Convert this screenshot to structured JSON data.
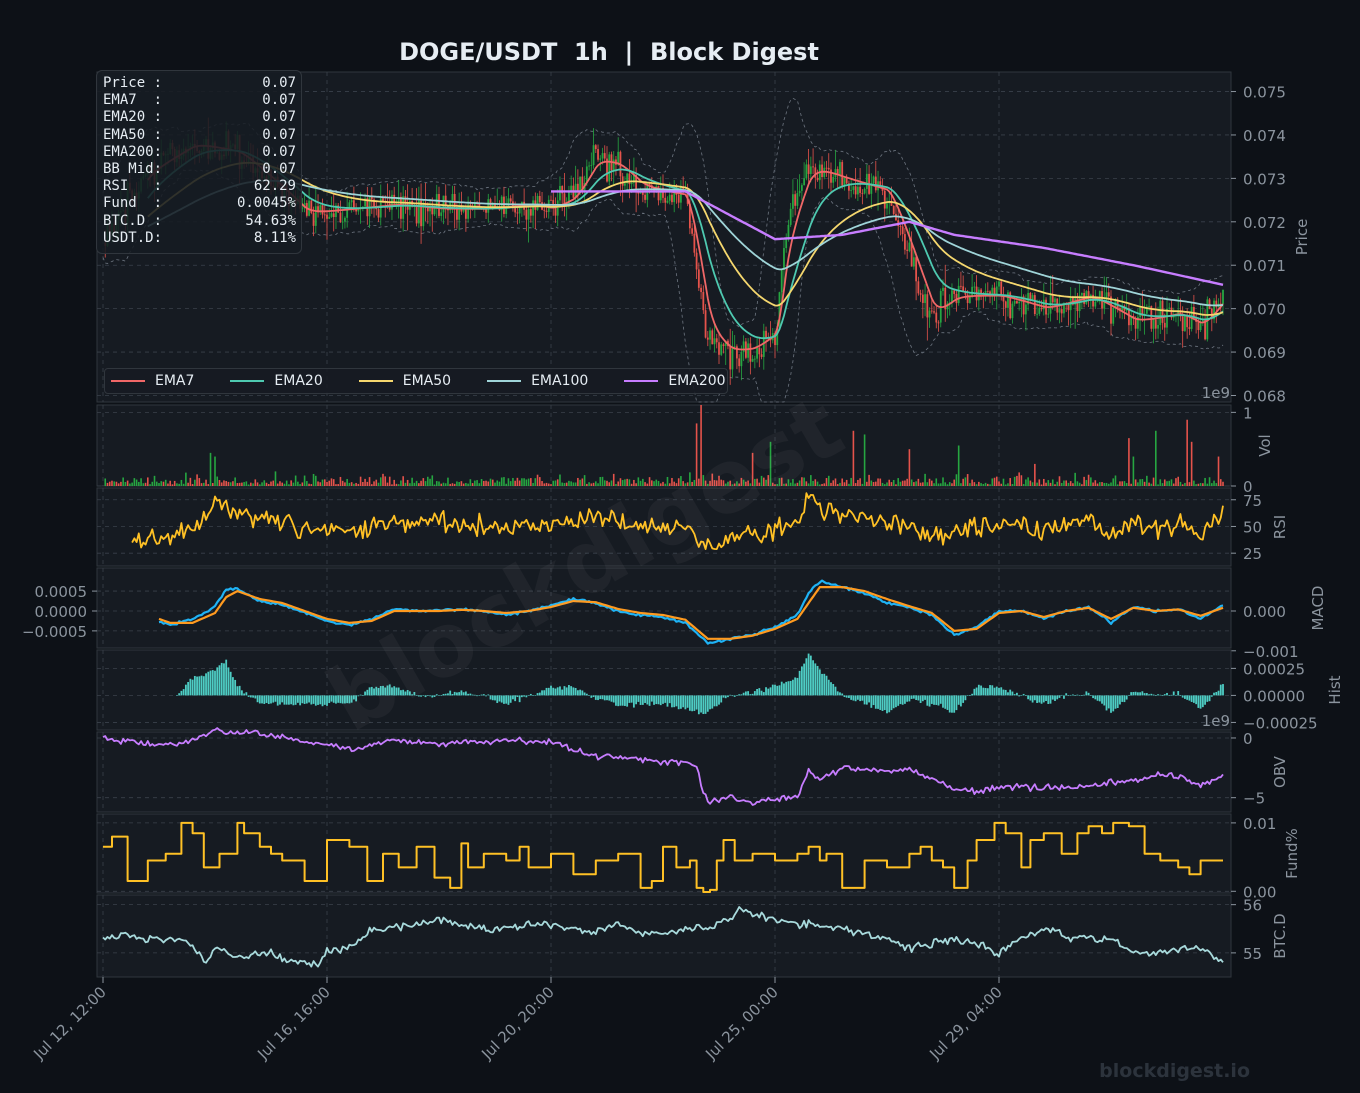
{
  "title": "DOGE/USDT  1h  |  Block Digest",
  "watermark": "blockdigest",
  "footer_brand": "blockdigest.io",
  "colors": {
    "background": "#0d1117",
    "panel": "#161b22",
    "grid": "#3a414b",
    "axis_text": "#8b949e",
    "candle_up": "#26a641",
    "candle_down": "#e5534b",
    "ema7": "#f06767",
    "ema20": "#4ec9b0",
    "ema50": "#f5d76e",
    "ema100": "#9fd4d8",
    "ema200": "#c77dff",
    "rsi": "#ffc125",
    "macd": "#1fb3f5",
    "signal": "#ff9a1f",
    "hist": "#4ecdc4",
    "obv": "#c77dff",
    "funding": "#ffc125",
    "btcd": "#a8dadc"
  },
  "info_box": [
    {
      "label": "Price :",
      "value": "0.07"
    },
    {
      "label": "EMA7  :",
      "value": "0.07"
    },
    {
      "label": "EMA20 :",
      "value": "0.07"
    },
    {
      "label": "EMA50 :",
      "value": "0.07"
    },
    {
      "label": "EMA200:",
      "value": "0.07"
    },
    {
      "label": "BB Mid:",
      "value": "0.07"
    },
    {
      "label": "RSI   :",
      "value": "62.29"
    },
    {
      "label": "Fund  :",
      "value": "0.0045%"
    },
    {
      "label": "BTC.D :",
      "value": "54.63%"
    },
    {
      "label": "USDT.D:",
      "value": "8.11%"
    }
  ],
  "legend": [
    {
      "label": "EMA7",
      "color": "#f06767"
    },
    {
      "label": "EMA20",
      "color": "#4ec9b0"
    },
    {
      "label": "EMA50",
      "color": "#f5d76e"
    },
    {
      "label": "EMA100",
      "color": "#9fd4d8"
    },
    {
      "label": "EMA200",
      "color": "#c77dff"
    }
  ],
  "x_axis": {
    "ticks": [
      "Jul 12, 12:00",
      "Jul 16, 16:00",
      "Jul 20, 20:00",
      "Jul 25, 00:00",
      "Jul 29, 04:00"
    ],
    "tick_hours": [
      0,
      100,
      200,
      300,
      400
    ],
    "range_hours": [
      0,
      500
    ]
  },
  "chart_data": [
    {
      "type": "line",
      "panel": "Price",
      "ylabel": "Price",
      "ylim": [
        0.06785,
        0.07545
      ],
      "yticks": [
        "0.075",
        "0.074",
        "0.073",
        "0.072",
        "0.071",
        "0.070",
        "0.069",
        "0.068"
      ],
      "ytick_values": [
        0.075,
        0.074,
        0.073,
        0.072,
        0.071,
        0.07,
        0.069,
        0.068
      ],
      "corner_label": "1e9",
      "price_anchors": {
        "x": [
          0,
          20,
          40,
          60,
          80,
          90,
          110,
          130,
          150,
          170,
          190,
          200,
          210,
          220,
          230,
          240,
          260,
          270,
          280,
          290,
          300,
          305,
          315,
          330,
          350,
          370,
          380,
          400,
          420,
          440,
          460,
          480,
          490,
          500
        ],
        "y": [
          0.0716,
          0.0732,
          0.0738,
          0.0736,
          0.0727,
          0.0722,
          0.0723,
          0.0724,
          0.0723,
          0.0723,
          0.0724,
          0.0723,
          0.0726,
          0.0735,
          0.0733,
          0.0728,
          0.0726,
          0.0693,
          0.069,
          0.0691,
          0.0695,
          0.072,
          0.0733,
          0.073,
          0.0727,
          0.0698,
          0.0703,
          0.0703,
          0.07,
          0.0703,
          0.0697,
          0.0699,
          0.0696,
          0.0703
        ]
      },
      "ema200_anchors": {
        "x": [
          200,
          260,
          300,
          330,
          360,
          380,
          420,
          460,
          500
        ],
        "y": [
          0.0727,
          0.0727,
          0.0716,
          0.0717,
          0.072,
          0.0717,
          0.0714,
          0.071,
          0.07055
        ]
      },
      "series": [
        {
          "name": "EMA7"
        },
        {
          "name": "EMA20"
        },
        {
          "name": "EMA50"
        },
        {
          "name": "EMA100"
        },
        {
          "name": "EMA200"
        }
      ]
    },
    {
      "type": "bar",
      "panel": "Volume",
      "ylabel": "Vol",
      "ylim": [
        0,
        1.1
      ],
      "yticks": [
        "1",
        "0"
      ],
      "ytick_values": [
        1,
        0
      ],
      "spikes": {
        "x": [
          48,
          50,
          265,
          267,
          290,
          298,
          335,
          340,
          360,
          382,
          416,
          458,
          460,
          470,
          484,
          486,
          498
        ],
        "y": [
          0.45,
          0.4,
          0.85,
          1.15,
          0.45,
          0.6,
          0.75,
          0.7,
          0.5,
          0.55,
          0.3,
          0.65,
          0.4,
          0.75,
          0.9,
          0.6,
          0.4
        ]
      }
    },
    {
      "type": "line",
      "panel": "RSI",
      "ylabel": "RSI",
      "ylim": [
        13,
        86
      ],
      "yticks": [
        "75",
        "50",
        "25"
      ],
      "ytick_values": [
        75,
        50,
        25
      ],
      "anchors": {
        "x": [
          13,
          20,
          30,
          40,
          46,
          50,
          60,
          70,
          90,
          110,
          130,
          150,
          170,
          190,
          210,
          220,
          240,
          260,
          265,
          270,
          280,
          290,
          300,
          310,
          315,
          320,
          330,
          345,
          360,
          370,
          380,
          390,
          400,
          420,
          440,
          450,
          460,
          470,
          480,
          490,
          500
        ],
        "y": [
          38,
          40,
          42,
          48,
          55,
          75,
          60,
          58,
          48,
          47,
          52,
          55,
          50,
          52,
          55,
          60,
          50,
          48,
          40,
          30,
          38,
          42,
          45,
          55,
          80,
          65,
          60,
          55,
          52,
          40,
          45,
          50,
          52,
          45,
          58,
          40,
          55,
          48,
          55,
          42,
          62
        ]
      }
    },
    {
      "type": "line",
      "panel": "MACD",
      "ylabel": "MACD",
      "ylim": [
        -0.00093,
        0.00108
      ],
      "yticks_left": [
        "0.0005",
        "0.0000",
        "−0.0005"
      ],
      "ytick_left_values": [
        0.0005,
        0.0,
        -0.0005
      ],
      "yticks_right": [
        "0.000",
        "−0.001"
      ],
      "ytick_right_values": [
        0.0,
        -0.001
      ],
      "macd_anchors": {
        "x": [
          25,
          30,
          40,
          50,
          55,
          60,
          70,
          80,
          90,
          100,
          110,
          120,
          130,
          140,
          150,
          160,
          170,
          180,
          190,
          200,
          210,
          220,
          230,
          240,
          250,
          260,
          270,
          280,
          290,
          300,
          310,
          315,
          320,
          330,
          340,
          350,
          360,
          370,
          380,
          390,
          400,
          410,
          420,
          430,
          440,
          450,
          460,
          470,
          480,
          490,
          500
        ],
        "y": [
          -0.00025,
          -0.00035,
          -0.0002,
          0.0001,
          0.00055,
          0.00055,
          0.00025,
          0.00015,
          -5e-05,
          -0.00025,
          -0.00035,
          -0.0002,
          5e-05,
          0.0,
          0.0,
          5e-05,
          0.0,
          -0.0001,
          0.0,
          0.00015,
          0.0003,
          0.0002,
          0.0,
          -0.0001,
          -0.00015,
          -0.0003,
          -0.0008,
          -0.0007,
          -0.0006,
          -0.0004,
          -0.0001,
          0.00045,
          0.00075,
          0.0006,
          0.00045,
          0.0002,
          0.0001,
          -0.0001,
          -0.0006,
          -0.0004,
          0.0,
          0.0,
          -0.0002,
          0.0,
          0.0001,
          -0.0003,
          0.0001,
          0.0,
          5e-05,
          -0.0002,
          0.00015
        ]
      },
      "signal_anchors": {
        "x": [
          25,
          30,
          40,
          50,
          55,
          60,
          70,
          80,
          90,
          100,
          110,
          120,
          130,
          140,
          150,
          160,
          170,
          180,
          190,
          200,
          210,
          220,
          230,
          240,
          250,
          260,
          270,
          280,
          290,
          300,
          310,
          315,
          320,
          330,
          340,
          350,
          360,
          370,
          380,
          390,
          400,
          410,
          420,
          430,
          440,
          450,
          460,
          470,
          480,
          490,
          500
        ],
        "y": [
          -0.0002,
          -0.0003,
          -0.0003,
          -5e-05,
          0.00035,
          0.0005,
          0.0003,
          0.0002,
          0.0,
          -0.0002,
          -0.0003,
          -0.00025,
          0.0,
          0.0,
          0.0,
          3e-05,
          0.0,
          -5e-05,
          0.0,
          0.0001,
          0.00025,
          0.00022,
          5e-05,
          -5e-05,
          -0.0001,
          -0.00022,
          -0.0007,
          -0.0007,
          -0.00062,
          -0.00045,
          -0.0002,
          0.0002,
          0.0006,
          0.0006,
          0.0005,
          0.0003,
          0.00012,
          -5e-05,
          -0.0005,
          -0.00045,
          -5e-05,
          0.0,
          -0.00015,
          0.0,
          8e-05,
          -0.0002,
          8e-05,
          0.0,
          4e-05,
          -0.00012,
          8e-05
        ]
      },
      "series": [
        {
          "name": "MACD"
        },
        {
          "name": "Signal"
        }
      ]
    },
    {
      "type": "bar",
      "panel": "Hist",
      "ylabel": "Hist",
      "ylim": [
        -0.00032,
        0.00042
      ],
      "yticks": [
        "0.00025",
        "0.00000",
        "−0.00025"
      ],
      "ytick_values": [
        0.00025,
        0.0,
        -0.00025
      ],
      "corner_label": "1e9"
    },
    {
      "type": "line",
      "panel": "OBV",
      "ylabel": "OBV",
      "ylim": [
        -6.2,
        0.5
      ],
      "yticks": [
        "0",
        "−5"
      ],
      "ytick_values": [
        0,
        -5
      ],
      "anchors": {
        "x": [
          0,
          20,
          30,
          40,
          50,
          60,
          70,
          90,
          100,
          110,
          130,
          150,
          160,
          170,
          180,
          190,
          200,
          210,
          220,
          240,
          250,
          260,
          265,
          267,
          270,
          280,
          290,
          300,
          310,
          315,
          320,
          330,
          350,
          360,
          380,
          390,
          400,
          420,
          440,
          460,
          470,
          480,
          490,
          500
        ],
        "y": [
          0,
          -0.5,
          -0.6,
          -0.2,
          0.8,
          0.3,
          0.4,
          -0.3,
          -0.5,
          -1.0,
          -0.2,
          -0.5,
          -0.3,
          -0.3,
          -0.1,
          -0.3,
          -0.3,
          -1.0,
          -1.5,
          -1.8,
          -2.0,
          -2.1,
          -2.3,
          -4.0,
          -5.5,
          -4.8,
          -5.5,
          -5.2,
          -5.0,
          -2.8,
          -3.5,
          -2.5,
          -2.8,
          -2.6,
          -4.3,
          -4.5,
          -4.0,
          -4.2,
          -4.0,
          -3.5,
          -3.0,
          -3.2,
          -4.0,
          -3.0
        ]
      }
    },
    {
      "type": "line",
      "panel": "Funding",
      "ylabel": "Fund%",
      "ylim": [
        -0.00025,
        0.0113
      ],
      "yticks": [
        "0.01",
        "0.00"
      ],
      "ytick_values": [
        0.01,
        0.0
      ],
      "anchors": {
        "x": [
          0,
          4,
          11,
          20,
          28,
          35,
          40,
          45,
          52,
          60,
          63,
          70,
          75,
          80,
          90,
          100,
          110,
          118,
          125,
          132,
          140,
          148,
          155,
          160,
          163,
          170,
          175,
          180,
          186,
          190,
          200,
          210,
          220,
          230,
          240,
          245,
          250,
          256,
          262,
          265,
          268,
          271,
          274,
          277,
          282,
          290,
          300,
          310,
          315,
          320,
          323,
          330,
          340,
          350,
          360,
          365,
          370,
          375,
          380,
          386,
          390,
          398,
          403,
          410,
          414,
          420,
          428,
          435,
          440,
          446,
          451,
          458,
          465,
          472,
          480,
          485,
          490,
          500
        ],
        "y": [
          0.0065,
          0.008,
          0.0015,
          0.0045,
          0.0055,
          0.01,
          0.0085,
          0.0035,
          0.0055,
          0.01,
          0.0085,
          0.0065,
          0.0055,
          0.0045,
          0.0015,
          0.0075,
          0.0065,
          0.0015,
          0.0055,
          0.0035,
          0.0065,
          0.002,
          0.0005,
          0.007,
          0.0035,
          0.0055,
          0.0055,
          0.0045,
          0.0065,
          0.0035,
          0.0055,
          0.0025,
          0.0045,
          0.0055,
          0.0005,
          0.0015,
          0.0065,
          0.0035,
          0.0045,
          0.0005,
          -0.0001,
          0.0002,
          0.0045,
          0.0075,
          0.0045,
          0.0055,
          0.0045,
          0.0055,
          0.0065,
          0.0045,
          0.0055,
          0.0005,
          0.0045,
          0.0035,
          0.0055,
          0.0065,
          0.0045,
          0.0035,
          0.0005,
          0.0045,
          0.0075,
          0.01,
          0.0085,
          0.0035,
          0.0075,
          0.0085,
          0.0055,
          0.0085,
          0.0095,
          0.0085,
          0.01,
          0.0095,
          0.0055,
          0.0045,
          0.0035,
          0.0025,
          0.0045,
          0.0045
        ]
      }
    },
    {
      "type": "line",
      "panel": "BTC.D",
      "ylabel": "BTC.D",
      "ylim": [
        54.5,
        56.2
      ],
      "yticks": [
        "56",
        "55"
      ],
      "ytick_values": [
        56,
        55
      ],
      "anchors": {
        "x": [
          0,
          10,
          20,
          30,
          40,
          46,
          50,
          60,
          70,
          75,
          80,
          90,
          95,
          100,
          110,
          120,
          130,
          140,
          150,
          160,
          170,
          180,
          190,
          200,
          210,
          220,
          230,
          240,
          250,
          260,
          270,
          280,
          285,
          290,
          300,
          310,
          320,
          330,
          340,
          350,
          360,
          370,
          380,
          390,
          400,
          410,
          420,
          425,
          430,
          440,
          450,
          460,
          470,
          480,
          490,
          500
        ],
        "y": [
          55.3,
          55.4,
          55.3,
          55.3,
          55.2,
          54.8,
          55.1,
          54.9,
          55.0,
          55.0,
          54.85,
          54.8,
          54.75,
          55.0,
          55.1,
          55.5,
          55.5,
          55.6,
          55.7,
          55.6,
          55.5,
          55.5,
          55.6,
          55.6,
          55.5,
          55.4,
          55.6,
          55.4,
          55.4,
          55.5,
          55.5,
          55.7,
          55.95,
          55.8,
          55.7,
          55.6,
          55.6,
          55.5,
          55.4,
          55.3,
          55.1,
          55.2,
          55.3,
          55.2,
          55.0,
          55.3,
          55.5,
          55.5,
          55.3,
          55.3,
          55.3,
          55.0,
          55.0,
          55.1,
          55.1,
          54.85
        ]
      }
    }
  ]
}
